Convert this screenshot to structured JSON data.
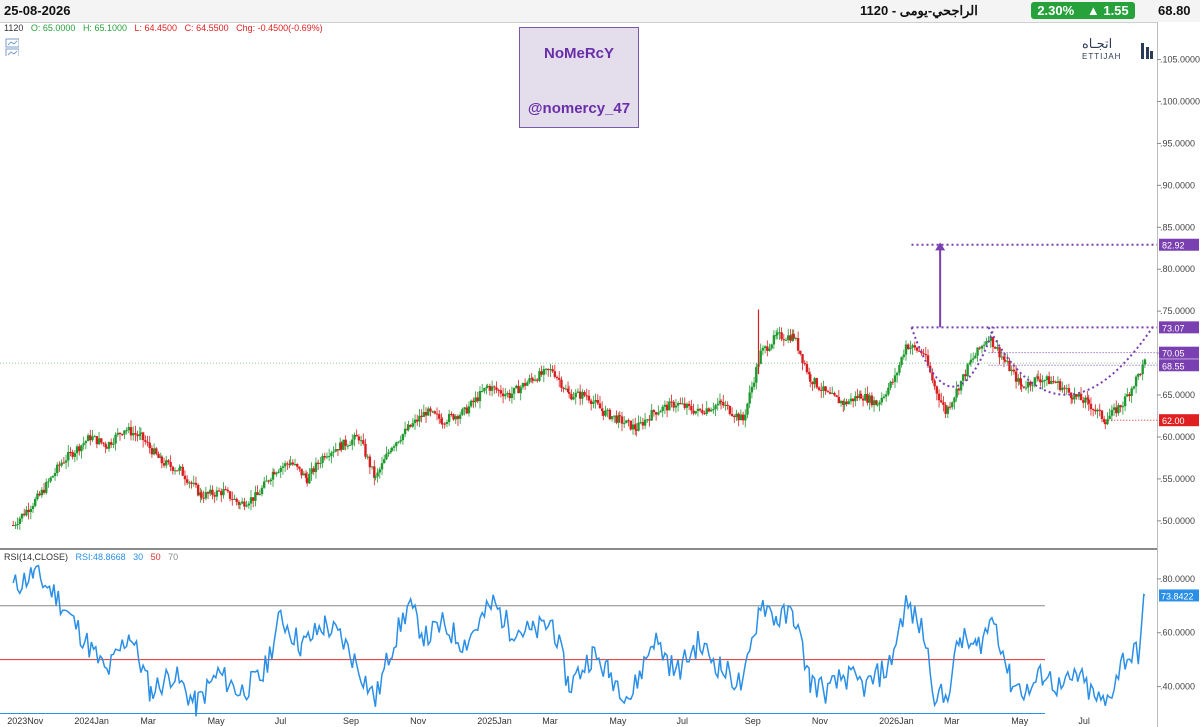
{
  "header": {
    "date": "25-08-2026",
    "title": "الراجحي-يومى - 1120",
    "change_pct": "2.30%",
    "change_abs": "1.55",
    "change_icon": "triangle-up-icon",
    "price": "68.80",
    "colors": {
      "up": "#27a13a"
    }
  },
  "ohlc": {
    "symbol": "1120",
    "open": "O: 65.0000",
    "high": "H: 65.1000",
    "low": "L: 64.4500",
    "close": "C: 64.5500",
    "chg": "Chg: -0.4500(-0.69%)"
  },
  "watermark": {
    "line1": "NoMeRcY",
    "line2": "@nomercy_47"
  },
  "logo": {
    "arabic": "اتجـاه",
    "english": "ETTIJAH"
  },
  "rsi_legend": {
    "name": "RSI(14,CLOSE)",
    "value": "RSI:48.8668",
    "l30": "30",
    "l50": "50",
    "l70": "70"
  },
  "chart_data": [
    {
      "type": "candlestick",
      "ylim": [
        47,
        109
      ],
      "yticks": [
        "50.0000",
        "55.0000",
        "60.0000",
        "65.0000",
        "70.0000",
        "75.0000",
        "80.0000",
        "85.0000",
        "90.0000",
        "95.0000",
        "100.0000",
        "105.0000"
      ],
      "xticks": [
        "2023Nov",
        "2024Jan",
        "Mar",
        "May",
        "Jul",
        "Sep",
        "Nov",
        "2025Jan",
        "Mar",
        "May",
        "Jul",
        "Sep",
        "Nov",
        "2026Jan",
        "Mar",
        "May",
        "Jul"
      ],
      "close_path": [
        [
          "2023-11-01",
          49.5
        ],
        [
          "2023-11-25",
          53
        ],
        [
          "2023-12-15",
          57
        ],
        [
          "2024-01-10",
          60
        ],
        [
          "2024-01-25",
          59
        ],
        [
          "2024-02-10",
          61
        ],
        [
          "2024-02-25",
          60
        ],
        [
          "2024-03-15",
          57
        ],
        [
          "2024-04-01",
          56
        ],
        [
          "2024-04-20",
          53
        ],
        [
          "2024-05-10",
          53.5
        ],
        [
          "2024-05-25",
          52
        ],
        [
          "2024-06-10",
          53
        ],
        [
          "2024-06-25",
          56
        ],
        [
          "2024-07-10",
          57
        ],
        [
          "2024-07-25",
          55
        ],
        [
          "2024-08-10",
          58
        ],
        [
          "2024-08-25",
          59
        ],
        [
          "2024-09-10",
          60
        ],
        [
          "2024-09-25",
          55
        ],
        [
          "2024-10-10",
          59
        ],
        [
          "2024-10-25",
          61
        ],
        [
          "2024-11-10",
          63
        ],
        [
          "2024-11-25",
          62
        ],
        [
          "2024-12-15",
          63
        ],
        [
          "2025-01-05",
          66
        ],
        [
          "2025-01-25",
          65
        ],
        [
          "2025-02-15",
          67
        ],
        [
          "2025-03-05",
          68
        ],
        [
          "2025-03-20",
          65
        ],
        [
          "2025-04-05",
          65
        ],
        [
          "2025-04-20",
          63
        ],
        [
          "2025-05-05",
          62
        ],
        [
          "2025-05-20",
          61
        ],
        [
          "2025-06-05",
          63
        ],
        [
          "2025-06-25",
          64
        ],
        [
          "2025-07-15",
          63
        ],
        [
          "2025-08-05",
          64
        ],
        [
          "2025-08-25",
          62
        ],
        [
          "2025-09-10",
          70
        ],
        [
          "2025-09-25",
          72
        ],
        [
          "2025-10-10",
          72
        ],
        [
          "2025-10-25",
          67
        ],
        [
          "2025-11-10",
          65
        ],
        [
          "2025-11-25",
          64
        ],
        [
          "2025-12-10",
          65
        ],
        [
          "2025-12-25",
          64
        ],
        [
          "2026-01-10",
          67
        ],
        [
          "2026-01-20",
          71
        ],
        [
          "2026-02-05",
          70
        ],
        [
          "2026-02-15",
          66
        ],
        [
          "2026-02-25",
          63
        ],
        [
          "2026-03-05",
          65
        ],
        [
          "2026-03-20",
          69
        ],
        [
          "2026-04-05",
          72
        ],
        [
          "2026-04-20",
          69
        ],
        [
          "2026-05-05",
          66
        ],
        [
          "2026-05-20",
          67
        ],
        [
          "2026-06-05",
          66.5
        ],
        [
          "2026-06-20",
          65
        ],
        [
          "2026-07-05",
          64
        ],
        [
          "2026-07-20",
          62
        ],
        [
          "2026-08-05",
          64
        ],
        [
          "2026-08-25",
          68.8
        ]
      ],
      "price_labels": [
        {
          "value": "82.92",
          "level": 82.92,
          "color": "#7a3fb0"
        },
        {
          "value": "73.07",
          "level": 73.07,
          "color": "#7a3fb0"
        },
        {
          "value": "70.05",
          "level": 70.05,
          "color": "#7a3fb0"
        },
        {
          "value": "68.55",
          "level": 68.55,
          "color": "#7a3fb0"
        },
        {
          "value": "62.00",
          "level": 62.0,
          "color": "#e02020"
        }
      ],
      "annotations": [
        "cup-and-handle pattern",
        "breakout target arrow"
      ]
    },
    {
      "type": "line",
      "name": "RSI(14,CLOSE)",
      "ylim": [
        25,
        87
      ],
      "yticks": [
        "40.0000",
        "60.0000",
        "80.0000"
      ],
      "levels": [
        30,
        50,
        70
      ],
      "last_value_label": "73.8422",
      "path": [
        [
          "2023-11-01",
          77
        ],
        [
          "2023-11-20",
          82
        ],
        [
          "2023-12-10",
          74
        ],
        [
          "2024-01-01",
          60
        ],
        [
          "2024-01-25",
          45
        ],
        [
          "2024-02-15",
          60
        ],
        [
          "2024-03-05",
          38
        ],
        [
          "2024-03-25",
          45
        ],
        [
          "2024-04-15",
          33
        ],
        [
          "2024-05-05",
          45
        ],
        [
          "2024-05-25",
          38
        ],
        [
          "2024-06-15",
          44
        ],
        [
          "2024-07-01",
          66
        ],
        [
          "2024-07-20",
          55
        ],
        [
          "2024-08-10",
          63
        ],
        [
          "2024-08-25",
          58
        ],
        [
          "2024-09-10",
          47
        ],
        [
          "2024-09-25",
          35
        ],
        [
          "2024-10-10",
          55
        ],
        [
          "2024-10-25",
          70
        ],
        [
          "2024-11-10",
          58
        ],
        [
          "2024-11-25",
          63
        ],
        [
          "2024-12-15",
          56
        ],
        [
          "2025-01-10",
          71
        ],
        [
          "2025-01-25",
          62
        ],
        [
          "2025-02-15",
          60
        ],
        [
          "2025-03-05",
          64
        ],
        [
          "2025-03-20",
          40
        ],
        [
          "2025-04-10",
          52
        ],
        [
          "2025-04-25",
          45
        ],
        [
          "2025-05-15",
          36
        ],
        [
          "2025-06-05",
          58
        ],
        [
          "2025-06-25",
          45
        ],
        [
          "2025-07-15",
          56
        ],
        [
          "2025-08-05",
          47
        ],
        [
          "2025-08-25",
          40
        ],
        [
          "2025-09-10",
          72
        ],
        [
          "2025-09-25",
          65
        ],
        [
          "2025-10-10",
          67
        ],
        [
          "2025-10-25",
          42
        ],
        [
          "2025-11-10",
          38
        ],
        [
          "2025-11-25",
          44
        ],
        [
          "2025-12-15",
          40
        ],
        [
          "2026-01-05",
          48
        ],
        [
          "2026-01-20",
          71
        ],
        [
          "2026-02-05",
          60
        ],
        [
          "2026-02-15",
          38
        ],
        [
          "2026-02-25",
          35
        ],
        [
          "2026-03-10",
          58
        ],
        [
          "2026-03-25",
          54
        ],
        [
          "2026-04-10",
          66
        ],
        [
          "2026-04-25",
          42
        ],
        [
          "2026-05-10",
          38
        ],
        [
          "2026-05-25",
          45
        ],
        [
          "2026-06-10",
          39
        ],
        [
          "2026-06-25",
          44
        ],
        [
          "2026-07-10",
          36
        ],
        [
          "2026-07-20",
          33
        ],
        [
          "2026-08-05",
          50
        ],
        [
          "2026-08-20",
          53
        ],
        [
          "2026-08-25",
          73.84
        ]
      ],
      "colors": {
        "line": "#2a8fe6",
        "level30": "#2a8fe6",
        "level50": "#e03030",
        "level70": "#888888"
      }
    }
  ]
}
